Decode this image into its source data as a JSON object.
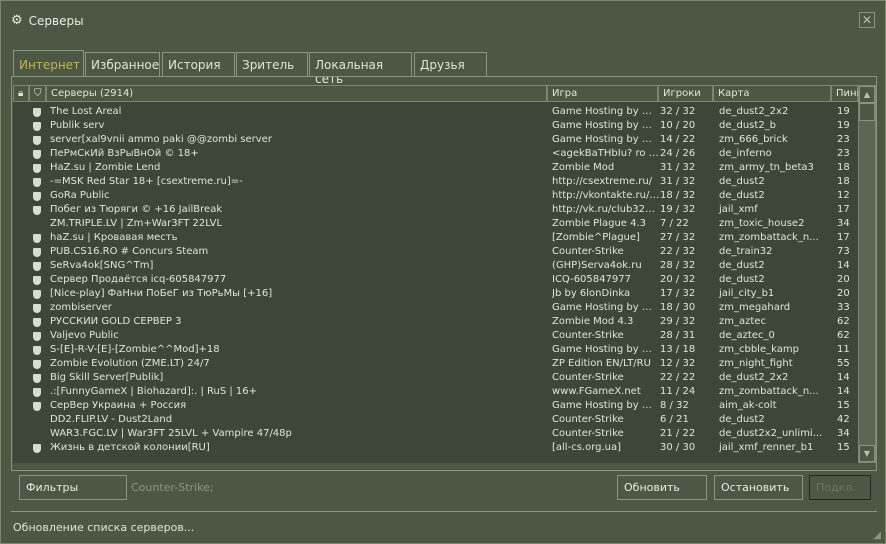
{
  "window": {
    "title": "Серверы",
    "close": "✕"
  },
  "tabs": [
    "Интернет",
    "Избранное",
    "История",
    "Зритель",
    "Локальная сеть",
    "Друзья"
  ],
  "columns": {
    "servers": "Серверы (2914)",
    "game": "Игра",
    "players": "Игроки",
    "map": "Карта",
    "ping": "Пинг"
  },
  "rows": [
    {
      "name": "The Lost Areal",
      "game": "Game Hosting by MyArena",
      "players": "32 / 32",
      "map": "de_dust2_2x2",
      "ping": "19",
      "secure": true
    },
    {
      "name": "Publik serv",
      "game": "Game Hosting by MyArena",
      "players": "10 / 20",
      "map": "de_dust2_b",
      "ping": "19",
      "secure": true
    },
    {
      "name": "server[xal9vnii ammo paki @@zombi  server",
      "game": "Game Hosting by MyArena",
      "players": "14 / 22",
      "map": "zm_666_brick",
      "ping": "23",
      "secure": true
    },
    {
      "name": "ПеРмСкИй ВзРыВнОй © 18+",
      "game": "<agekBaTHbIu? ro k ...",
      "players": "24 / 26",
      "map": "de_inferno",
      "ping": "23",
      "secure": true
    },
    {
      "name": "HaZ.su | Zombie Lend",
      "game": "Zombie Mod",
      "players": "31 / 32",
      "map": "zm_army_tn_beta3",
      "ping": "18",
      "secure": true
    },
    {
      "name": "-=MSK Red Star 18+ [csextreme.ru]=-",
      "game": "http://csextreme.ru/",
      "players": "31 / 32",
      "map": "de_dust2",
      "ping": "18",
      "secure": true
    },
    {
      "name": "GoRa Public",
      "game": "http://vkontakte.ru/club",
      "players": "18 / 32",
      "map": "de_dust2",
      "ping": "12",
      "secure": true
    },
    {
      "name": "Побег из Тюряги © +16 JailBreak",
      "game": "http://vk.ru/club32663...",
      "players": "19 / 32",
      "map": "jail_xmf",
      "ping": "17",
      "secure": true
    },
    {
      "name": "ZM.TRIPLE.LV | Zm+War3FT 22LVL",
      "game": "Zombie Plague 4.3",
      "players": "7 / 22",
      "map": "zm_toxic_house2",
      "ping": "34",
      "secure": false
    },
    {
      "name": "haZ.su | Кровавая месть",
      "game": "[Zombie^Plague]",
      "players": "27 / 32",
      "map": "zm_zombattack_n...",
      "ping": "17",
      "secure": true
    },
    {
      "name": "PUB.CS16.RO # Concurs Steam",
      "game": "Counter-Strike",
      "players": "22 / 32",
      "map": "de_train32",
      "ping": "73",
      "secure": true
    },
    {
      "name": "SeRva4ok[SNG^Tm]",
      "game": "(GHP)Serva4ok.ru",
      "players": "28 / 32",
      "map": "de_dust2",
      "ping": "14",
      "secure": true
    },
    {
      "name": "Сервер Продаётся icq-605847977",
      "game": "ICQ-605847977",
      "players": "20 / 32",
      "map": "de_dust2",
      "ping": "20",
      "secure": true
    },
    {
      "name": "[Nice-play] ФаНни ПоБеГ из ТюРьМы [+16]",
      "game": "Jb by 6lonDinka",
      "players": "17 / 32",
      "map": "jail_city_b1",
      "ping": "20",
      "secure": true
    },
    {
      "name": "zombiserver",
      "game": "Game Hosting by MyArena",
      "players": "18 / 30",
      "map": "zm_megahard",
      "ping": "33",
      "secure": true
    },
    {
      "name": "РУССКИЙ GOLD СЕРВЕР 3",
      "game": "Zombie Mod 4.3",
      "players": "29 / 32",
      "map": "zm_aztec",
      "ping": "62",
      "secure": true
    },
    {
      "name": "Valjevo Public",
      "game": "Counter-Strike",
      "players": "28 / 31",
      "map": "de_aztec_0",
      "ping": "62",
      "secure": true
    },
    {
      "name": "S-[E]-R-V-[E]-[Zombie^^Mod]+18",
      "game": "Game Hosting by MyArena",
      "players": "13 / 18",
      "map": "zm_cbble_kamp",
      "ping": "11",
      "secure": true
    },
    {
      "name": "Zombie Evolution (ZME.LT) 24/7",
      "game": "ZP Edition EN/LT/RU",
      "players": "12 / 32",
      "map": "zm_night_fight",
      "ping": "55",
      "secure": true
    },
    {
      "name": "Big Skill Server[Publik]",
      "game": "Counter-Strike",
      "players": "22 / 22",
      "map": "de_dust2_2x2",
      "ping": "14",
      "secure": true
    },
    {
      "name": ".:[FunnyGameX | Biohazard]:. | RuS | 16+",
      "game": "www.FGameX.net",
      "players": "11 / 24",
      "map": "zm_zombattack_n...",
      "ping": "14",
      "secure": true
    },
    {
      "name": "СерВер Украина + Россия",
      "game": "Game Hosting by MyArena",
      "players": "8 / 32",
      "map": "aim_ak-colt",
      "ping": "15",
      "secure": true
    },
    {
      "name": "DD2.FLIP.LV - Dust2Land",
      "game": "Counter-Strike",
      "players": "6 / 21",
      "map": "de_dust2",
      "ping": "42",
      "secure": false
    },
    {
      "name": "WAR3.FGC.LV | War3FT 25LVL + Vampire 47/48p",
      "game": "Counter-Strike",
      "players": "21 / 22",
      "map": "de_dust2x2_unlimi...",
      "ping": "34",
      "secure": false
    },
    {
      "name": "Жизнь в детской колонии[RU]",
      "game": "[all-cs.org.ua]",
      "players": "30 / 30",
      "map": "jail_xmf_renner_b1",
      "ping": "15",
      "secure": true
    }
  ],
  "footer": {
    "filters": "Фильтры",
    "filter_text": "Counter-Strike;",
    "refresh": "Обновить",
    "stop": "Остановить",
    "connect": "Подкл."
  },
  "status": "Обновление списка серверов...",
  "colors": {
    "window": "#4c5844",
    "list": "#3e4637",
    "active_tab": "#c4b550"
  }
}
